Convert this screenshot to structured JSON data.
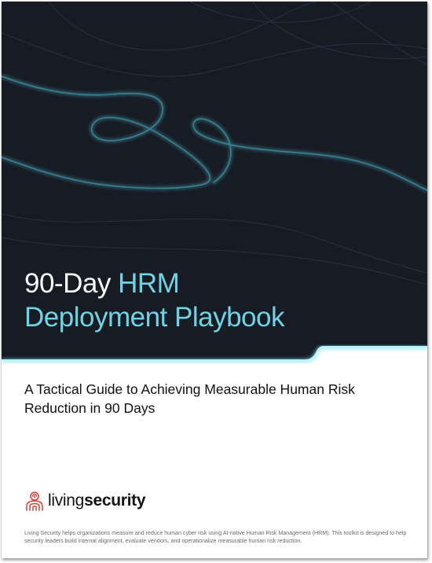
{
  "cover": {
    "title_line1_plain": "90-Day ",
    "title_line1_accent": "HRM",
    "title_line2": "Deployment Playbook",
    "subtitle": "A Tactical Guide to Achieving Measurable Human Risk Reduction in 90 Days"
  },
  "brand": {
    "name_regular": "living",
    "name_bold": "security",
    "logo_icon": "person-fingerprint-icon",
    "accent_color": "#6fd3e4",
    "logo_color": "#e0403a",
    "dark_background": "#161b24"
  },
  "footer": {
    "note": "Living Security helps organizations measure and reduce human cyber risk using AI-native Human Risk Management (HRM). This toolkit is designed to help security leaders build internal alignment, evaluate vendors, and operationalize measurable human risk reduction."
  }
}
